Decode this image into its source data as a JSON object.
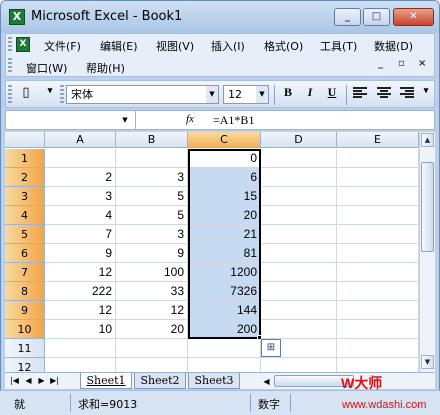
{
  "window": {
    "title": "Microsoft Excel - Book1",
    "app_icon": "excel-icon"
  },
  "menubar": {
    "row1": [
      "文件(F)",
      "编辑(E)",
      "视图(V)",
      "插入(I)",
      "格式(O)",
      "工具(T)",
      "数据(D)"
    ],
    "row2": [
      "窗口(W)",
      "帮助(H)"
    ]
  },
  "toolbar": {
    "font_name": "宋体",
    "font_size": "12",
    "bold": "B",
    "italic": "I",
    "underline": "U"
  },
  "formula_bar": {
    "name_box": "",
    "fx": "fx",
    "formula": "=A1*B1"
  },
  "sheet": {
    "columns": [
      "A",
      "B",
      "C",
      "D",
      "E"
    ],
    "selected_column": "C",
    "rows": [
      {
        "n": "1",
        "a": "",
        "b": "",
        "c": "0"
      },
      {
        "n": "2",
        "a": "2",
        "b": "3",
        "c": "6"
      },
      {
        "n": "3",
        "a": "3",
        "b": "5",
        "c": "15"
      },
      {
        "n": "4",
        "a": "4",
        "b": "5",
        "c": "20"
      },
      {
        "n": "5",
        "a": "7",
        "b": "3",
        "c": "21"
      },
      {
        "n": "6",
        "a": "9",
        "b": "9",
        "c": "81"
      },
      {
        "n": "7",
        "a": "12",
        "b": "100",
        "c": "1200"
      },
      {
        "n": "8",
        "a": "222",
        "b": "33",
        "c": "7326"
      },
      {
        "n": "9",
        "a": "12",
        "b": "12",
        "c": "144"
      },
      {
        "n": "10",
        "a": "10",
        "b": "20",
        "c": "200"
      },
      {
        "n": "11",
        "a": "",
        "b": "",
        "c": ""
      },
      {
        "n": "12",
        "a": "",
        "b": "",
        "c": ""
      }
    ]
  },
  "tabs": [
    "Sheet1",
    "Sheet2",
    "Sheet3"
  ],
  "active_tab": "Sheet1",
  "status": {
    "ready": "就",
    "sum": "求和=9013",
    "mode": "数字"
  },
  "watermark": {
    "logo": "W大师",
    "url": "www.wdashi.com"
  },
  "colors": {
    "selection": "#c6dbf2",
    "header_selected": "#f2b256",
    "watermark": "#dd1111"
  }
}
